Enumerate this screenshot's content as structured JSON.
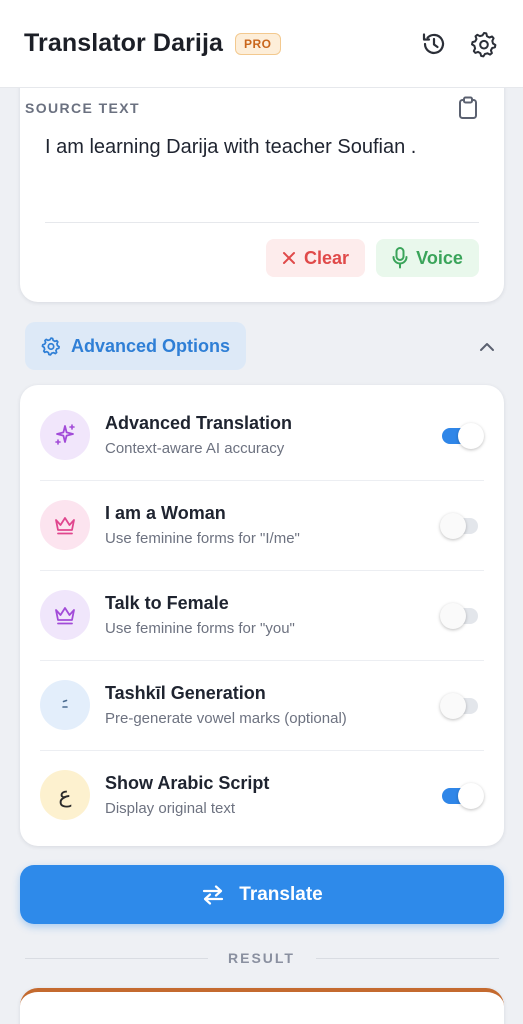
{
  "header": {
    "title": "Translator Darija",
    "badge": "PRO",
    "icons": [
      "history-icon",
      "settings-icon"
    ]
  },
  "source": {
    "label": "SOURCE TEXT",
    "text": "I am learning Darija with teacher Soufian .",
    "clear_label": "Clear",
    "voice_label": "Voice"
  },
  "advanced": {
    "label": "Advanced Options",
    "expanded": true,
    "options": [
      {
        "title": "Advanced Translation",
        "subtitle": "Context-aware AI accuracy",
        "enabled": true,
        "icon": "sparkles-icon",
        "icon_bg": "#f1e6fb",
        "icon_color": "#a24bd8"
      },
      {
        "title": "I am a Woman",
        "subtitle": "Use feminine forms for \"I/me\"",
        "enabled": false,
        "icon": "crown-icon",
        "icon_bg": "#fce4ef",
        "icon_color": "#e0468e"
      },
      {
        "title": "Talk to Female",
        "subtitle": "Use feminine forms for \"you\"",
        "enabled": false,
        "icon": "crown-icon",
        "icon_bg": "#f0e6fb",
        "icon_color": "#a24bd8"
      },
      {
        "title": "Tashkīl Generation",
        "subtitle": "Pre-generate vowel marks (optional)",
        "enabled": false,
        "icon": "tashkil-icon",
        "icon_bg": "#e3eefb",
        "icon_color": "#4a6a8f"
      },
      {
        "title": "Show Arabic Script",
        "subtitle": "Display original text",
        "enabled": true,
        "icon": "arabic-letter-icon",
        "icon_glyph": "ع",
        "icon_bg": "#fdf1cf",
        "icon_color": "#2a2a2a"
      }
    ]
  },
  "translate_label": "Translate",
  "result_label": "RESULT",
  "colors": {
    "primary": "#2e8aea",
    "accent_orange": "#c46a2f",
    "clear_red": "#e04a4a",
    "voice_green": "#3aa45a"
  }
}
